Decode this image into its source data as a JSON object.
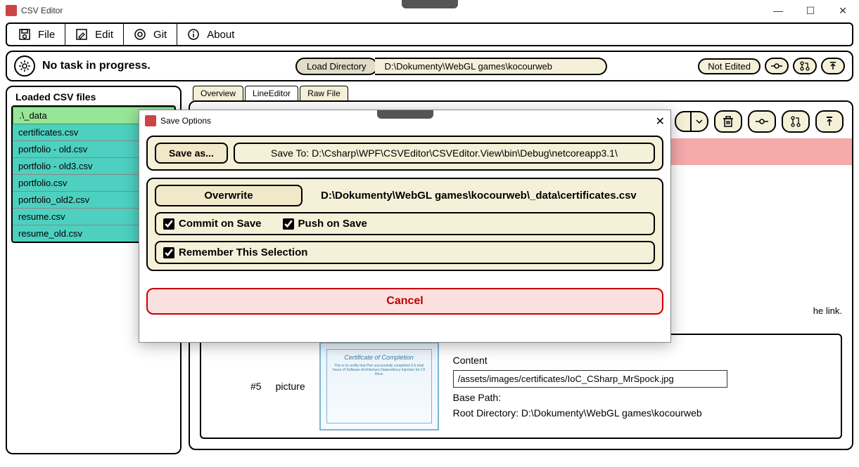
{
  "window": {
    "title": "CSV Editor",
    "minimize": "—",
    "maximize": "☐",
    "close": "✕"
  },
  "menu": {
    "file": "File",
    "edit": "Edit",
    "git": "Git",
    "about": "About"
  },
  "taskbar": {
    "status": "No task in progress.",
    "load_btn": "Load Directory",
    "dir_path": "D:\\Dokumenty\\WebGL games\\kocourweb",
    "edit_status": "Not Edited"
  },
  "sidebar": {
    "title": "Loaded CSV files",
    "root": ".\\_data",
    "files": [
      "certificates.csv",
      "portfolio - old.csv",
      "portfolio - old3.csv",
      "portfolio.csv",
      "portfolio_old2.csv",
      "resume.csv",
      "resume_old.csv"
    ]
  },
  "tabs": {
    "overview": "Overview",
    "lineeditor": "LineEditor",
    "rawfile": "Raw File"
  },
  "link_hint": "he link.",
  "row5": {
    "index": "#5",
    "key": "picture",
    "cert_title": "Certificate of Completion",
    "content_label": "Content",
    "content_value": "/assets/images/certificates/IoC_CSharp_MrSpock.jpg",
    "basepath_label": "Base Path:",
    "rootdir": "Root Directory: D:\\Dokumenty\\WebGL games\\kocourweb"
  },
  "modal": {
    "title": "Save Options",
    "save_as": "Save as...",
    "save_to": "Save To:  D:\\Csharp\\WPF\\CSVEditor\\CSVEditor.View\\bin\\Debug\\netcoreapp3.1\\",
    "overwrite": "Overwrite",
    "overwrite_path": "D:\\Dokumenty\\WebGL games\\kocourweb\\_data\\certificates.csv",
    "commit_on_save": "Commit on Save",
    "push_on_save": "Push on Save",
    "remember": "Remember This Selection",
    "cancel": "Cancel"
  }
}
